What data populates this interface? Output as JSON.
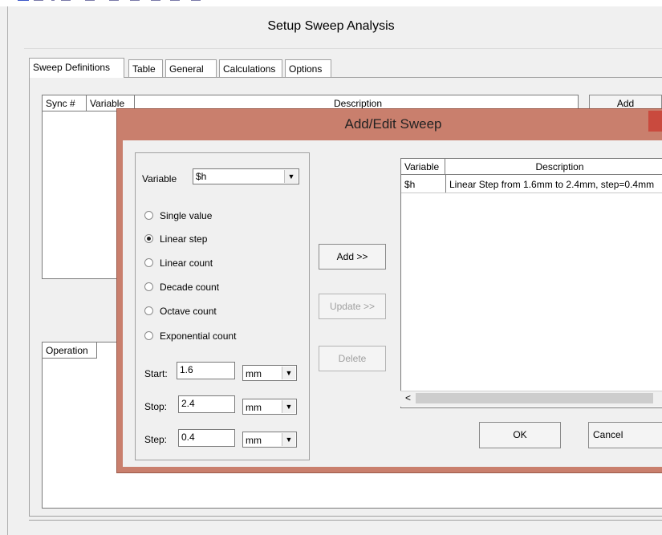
{
  "main": {
    "title": "Setup Sweep Analysis",
    "tabs": [
      "Sweep Definitions",
      "Table",
      "General",
      "Calculations",
      "Options"
    ],
    "sync_columns": [
      "Sync #",
      "Variable",
      "Description"
    ],
    "add_button_partial": "Add",
    "operation_header": "Operation"
  },
  "dialog": {
    "title": "Add/Edit Sweep",
    "variable_label": "Variable",
    "variable_value": "$h",
    "sweep_types": [
      "Single value",
      "Linear step",
      "Linear count",
      "Decade count",
      "Octave count",
      "Exponential count"
    ],
    "selected_type": "Linear step",
    "fields": [
      {
        "label": "Start:",
        "value": "1.6",
        "unit": "mm"
      },
      {
        "label": "Stop:",
        "value": "2.4",
        "unit": "mm"
      },
      {
        "label": "Step:",
        "value": "0.4",
        "unit": "mm"
      }
    ],
    "buttons": {
      "add": "Add >>",
      "update": "Update >>",
      "delete": "Delete",
      "ok": "OK",
      "cancel": "Cancel"
    },
    "table": {
      "headers": [
        "Variable",
        "Description"
      ],
      "rows": [
        {
          "variable": "$h",
          "description": "Linear Step from 1.6mm to 2.4mm, step=0.4mm"
        }
      ]
    }
  },
  "colors": {
    "dialog_frame": "#c97f6d",
    "close_button": "#c94a3e"
  }
}
